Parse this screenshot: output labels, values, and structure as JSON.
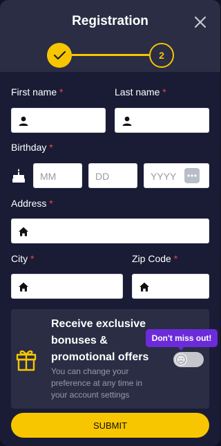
{
  "header": {
    "title": "Registration",
    "steps": {
      "current": 1,
      "step2_label": "2"
    }
  },
  "form": {
    "first_name_label": "First name",
    "last_name_label": "Last name",
    "birthday_label": "Birthday",
    "address_label": "Address",
    "city_label": "City",
    "zip_label": "Zip Code",
    "required_marker": "*",
    "month_placeholder": "MM",
    "day_placeholder": "DD",
    "year_placeholder": "YYYY"
  },
  "promo": {
    "title": "Receive exclusive bonuses & promotional offers",
    "subtitle": "You can change your preference at any time in your account settings",
    "tooltip": "Don't miss out!",
    "toggle_on": false
  },
  "submit_label": "SUBMIT",
  "colors": {
    "accent": "#f7c600",
    "required": "#e8454c",
    "tooltip": "#6c2bd9",
    "panel": "#2a2d44",
    "background": "#1a1c36"
  },
  "icons": [
    "close-icon",
    "check-icon",
    "person-icon",
    "cake-icon",
    "calendar-icon",
    "home-icon",
    "gift-icon",
    "sad-face-icon"
  ]
}
